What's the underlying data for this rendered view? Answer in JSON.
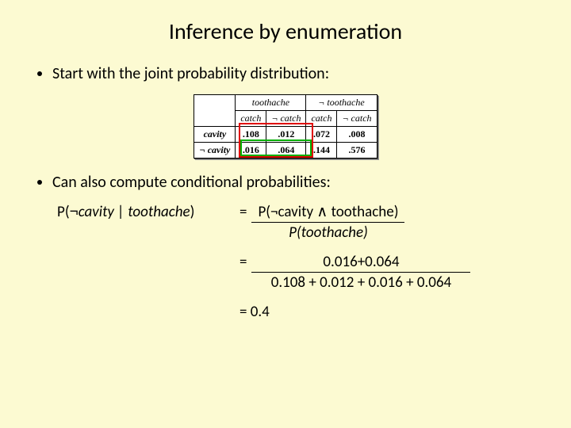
{
  "title": "Inference by enumeration",
  "bullet1": "Start with the joint probability distribution:",
  "bullet2": "Can also compute conditional probabilities:",
  "table": {
    "col_group1": "toothache",
    "col_group2": "¬ toothache",
    "sub_catch": "catch",
    "sub_notcatch": "¬ catch",
    "row1_label": "cavity",
    "row2_label": "¬ cavity",
    "r1c1": ".108",
    "r1c2": ".012",
    "r1c3": ".072",
    "r1c4": ".008",
    "r2c1": ".016",
    "r2c2": ".064",
    "r2c3": ".144",
    "r2c4": ".576"
  },
  "math": {
    "lhs_prefix": "P(",
    "lhs_neg": "¬",
    "lhs_mid": "cavity | toothache",
    "lhs_suffix": ")",
    "rhs1_num": "P(¬cavity ∧ toothache)",
    "rhs1_den": "P(toothache)",
    "rhs2_num": "0.016+0.064",
    "rhs2_den": "0.108 + 0.012 + 0.016 + 0.064",
    "result": "= 0.4"
  }
}
